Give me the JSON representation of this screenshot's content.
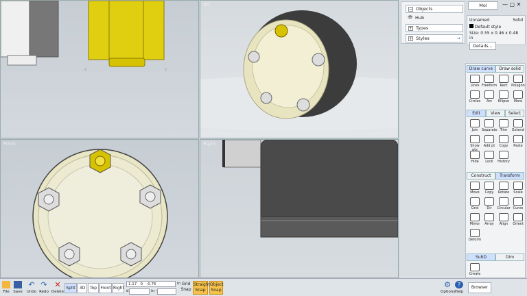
{
  "viewports": {
    "top": "Top",
    "3d": "3D",
    "front": "Front",
    "right": "Right"
  },
  "objects": {
    "items": [
      "Objects",
      "Hub",
      "Types",
      "Styles"
    ]
  },
  "properties": {
    "tab": "Mol",
    "name": "Unnamed",
    "kind": "Solid",
    "style": "Default style",
    "size": "Size: 0.55 x 0.46 x 0.48 in",
    "details": "Details..."
  },
  "palette": {
    "draw_tabs": [
      "Draw curve",
      "Draw solid"
    ],
    "draw": [
      "Lines",
      "Freeform",
      "Rect",
      "Polygon",
      "Circles",
      "Arc",
      "Ellipse",
      "More"
    ],
    "edit_tabs": [
      "Edit",
      "View",
      "Select"
    ],
    "edit": [
      "Join",
      "Separate",
      "Trim",
      "Extend",
      "Show pts",
      "Add pt",
      "Copy",
      "Paste",
      "Hide",
      "Lock",
      "History"
    ],
    "construct_tabs": [
      "Construct",
      "Transform"
    ],
    "transform": [
      "Move",
      "Copy",
      "Rotate",
      "Scale",
      "Grid",
      "Dir",
      "Circular",
      "Curve",
      "Mirror",
      "Array",
      "Align",
      "Orient",
      "Deform"
    ],
    "subd_tabs": [
      "SubD",
      "Dim"
    ],
    "subd": [
      "Create"
    ]
  },
  "bottom": {
    "file": "File",
    "save": "Save",
    "undo": "Undo",
    "redo": "Redo",
    "delete": "Delete",
    "views": [
      "Split",
      "3D",
      "Top",
      "Front",
      "Right"
    ],
    "coord_x": "1.17",
    "coord_y": "0",
    "coord_z": "-0.76",
    "unit": "in",
    "d_label": "d",
    "in_label": "in -",
    "grid_snap": [
      "Grid",
      "Snap"
    ],
    "straight_snap": [
      "Straight",
      "Snap"
    ],
    "object_snap": [
      "Object",
      "Snap"
    ],
    "options": "Options",
    "help": "Help",
    "browser": "Browser"
  },
  "colors": {
    "accent": "#cfe0ff",
    "hub": "#eeeac4",
    "bolt": "#d8d8d8",
    "gold_bolt": "#d6c200",
    "snap": "#f6c24a"
  }
}
